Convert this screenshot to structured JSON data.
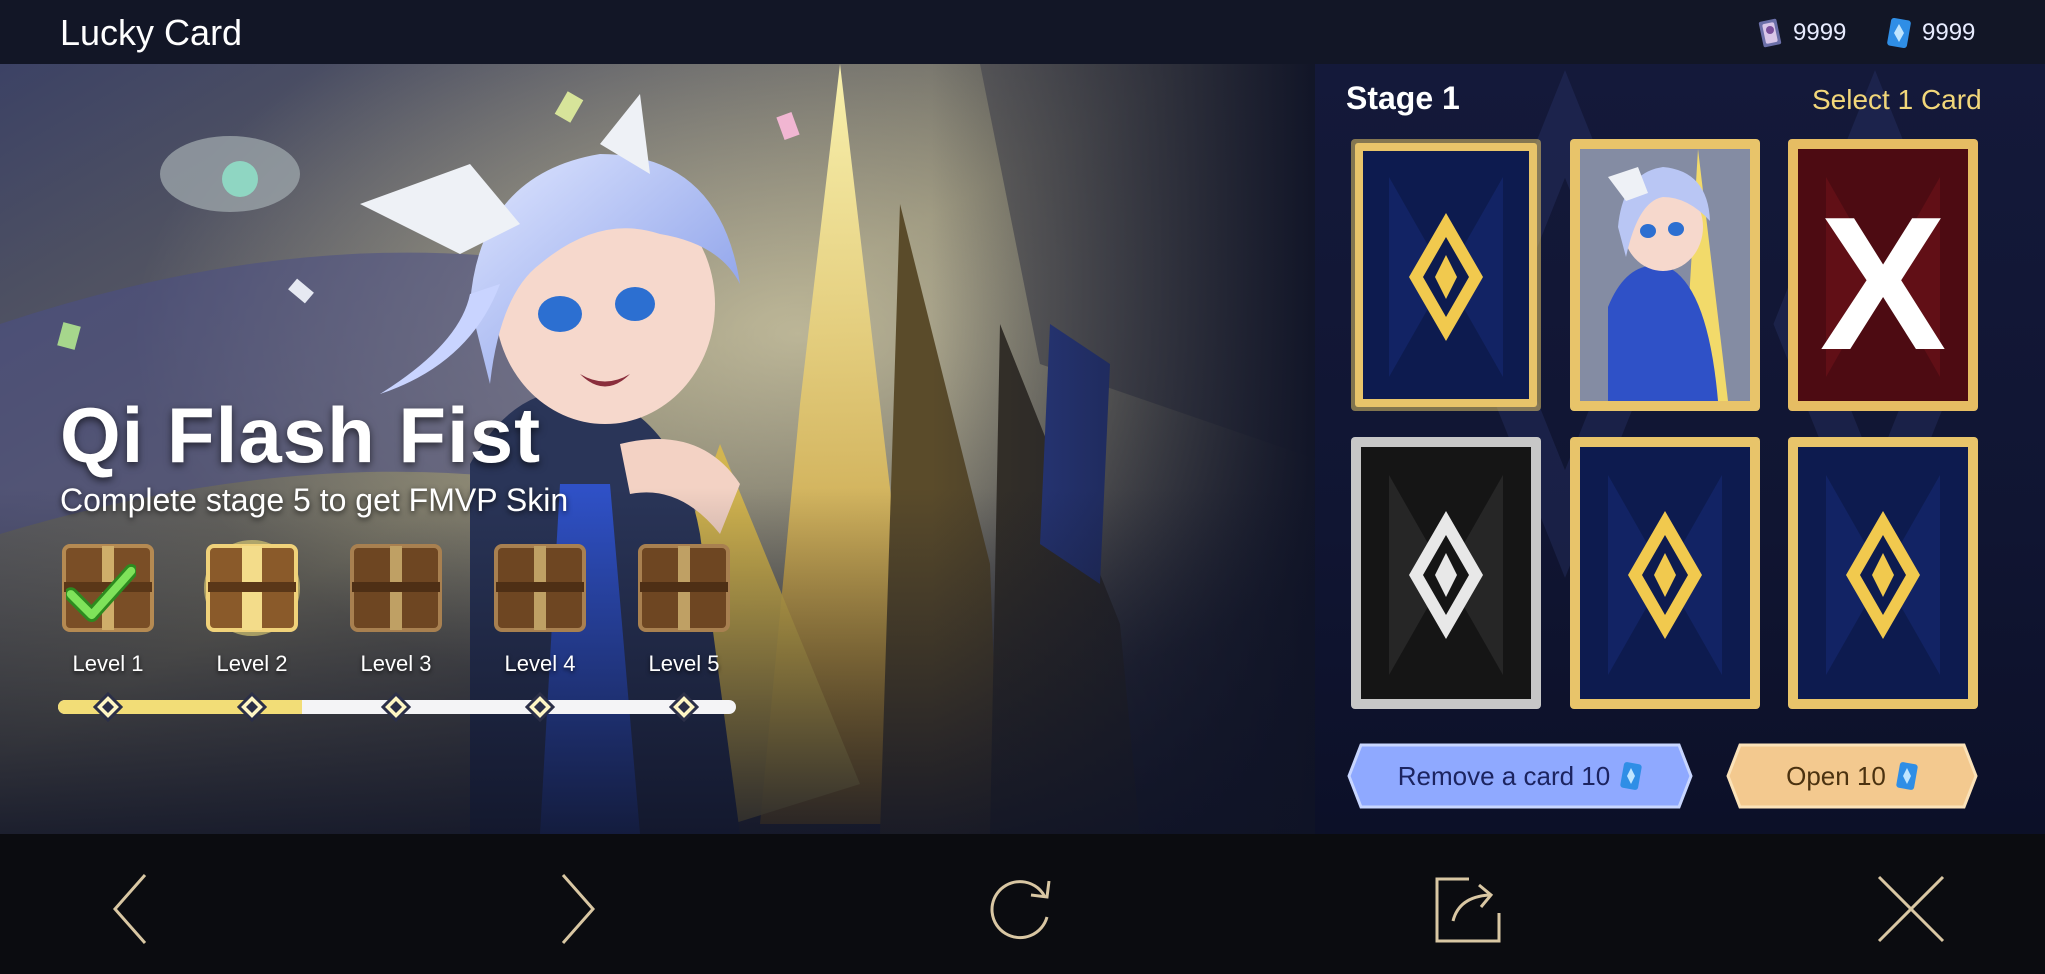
{
  "header": {
    "title": "Lucky Card",
    "currencies": [
      {
        "icon": "ticket-icon",
        "value": "9999"
      },
      {
        "icon": "diamond-icon",
        "value": "9999"
      }
    ]
  },
  "promo": {
    "title": "Qi Flash Fist",
    "subtitle": "Complete stage 5 to get FMVP Skin",
    "levels": [
      {
        "label": "Level 1",
        "state": "completed"
      },
      {
        "label": "Level 2",
        "state": "current"
      },
      {
        "label": "Level 3",
        "state": "locked"
      },
      {
        "label": "Level 4",
        "state": "locked"
      },
      {
        "label": "Level 5",
        "state": "locked"
      }
    ],
    "progress_fraction": 0.36
  },
  "stage": {
    "title": "Stage 1",
    "instruction": "Select 1 Card",
    "cards": [
      {
        "state": "face-down",
        "selected": true
      },
      {
        "state": "revealed-skin"
      },
      {
        "state": "removed",
        "mark": "X"
      },
      {
        "state": "face-down-silver"
      },
      {
        "state": "face-down"
      },
      {
        "state": "face-down"
      }
    ]
  },
  "actions": {
    "remove_label": "Remove a card 10",
    "open_label": "Open 10"
  },
  "nav": [
    {
      "icon": "chevron-left-icon"
    },
    {
      "icon": "chevron-right-icon"
    },
    {
      "icon": "refresh-icon"
    },
    {
      "icon": "share-icon"
    },
    {
      "icon": "close-icon"
    }
  ],
  "colors": {
    "accent_gold": "#f2d77a",
    "header_bg": "#121626",
    "card_blue": "#0d1b4f",
    "card_red": "#5a0d12",
    "remove_button": "#8fa9ff",
    "open_button": "#f3c98f"
  }
}
